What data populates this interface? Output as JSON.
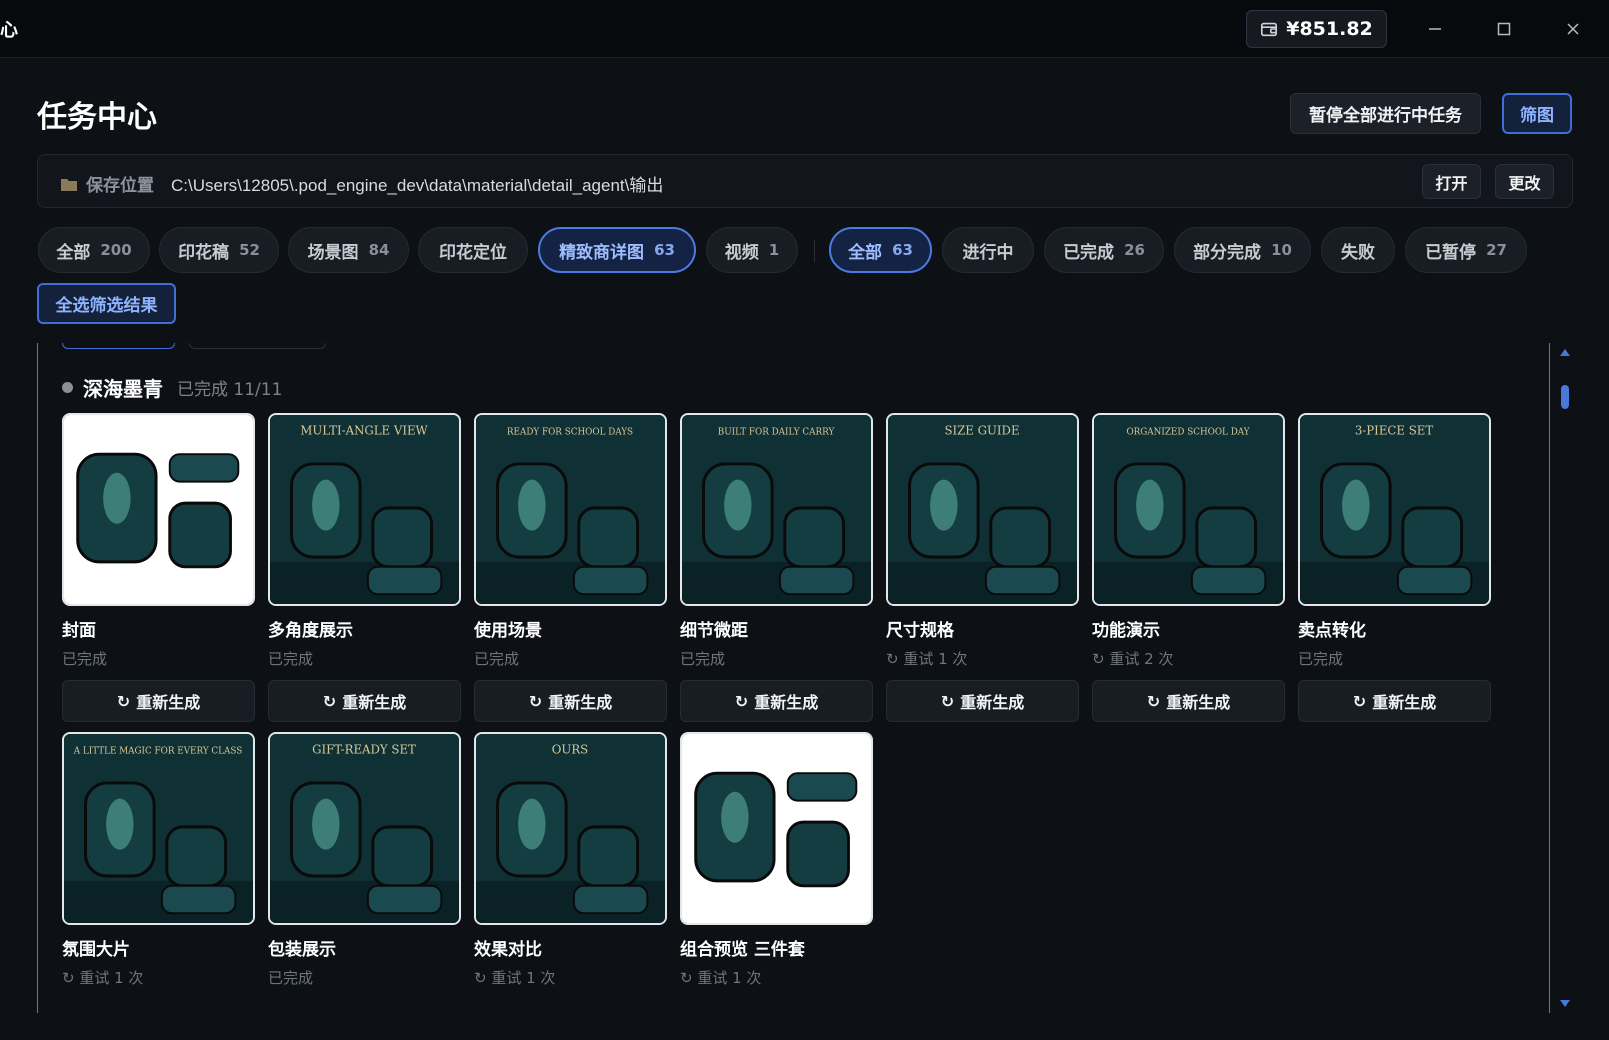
{
  "titlebar": {
    "logo_char": "心",
    "balance": "¥851.82",
    "icons": [
      "wallet-icon",
      "minimize-icon",
      "maximize-icon",
      "close-icon"
    ]
  },
  "header": {
    "title": "任务中心",
    "pause_all_label": "暂停全部进行中任务",
    "filter_label": "筛图"
  },
  "save_location": {
    "label": "保存位置",
    "path": "C:\\Users\\12805\\.pod_engine_dev\\data\\material\\detail_agent\\输出",
    "open_label": "打开",
    "change_label": "更改"
  },
  "type_filters": [
    {
      "label": "全部",
      "count": "200",
      "active": false
    },
    {
      "label": "印花稿",
      "count": "52",
      "active": false
    },
    {
      "label": "场景图",
      "count": "84",
      "active": false
    },
    {
      "label": "印花定位",
      "count": "",
      "active": false
    },
    {
      "label": "精致商详图",
      "count": "63",
      "active": true
    },
    {
      "label": "视频",
      "count": "1",
      "active": false
    }
  ],
  "status_filters": [
    {
      "label": "全部",
      "count": "63",
      "active": true
    },
    {
      "label": "进行中",
      "count": "",
      "active": false
    },
    {
      "label": "已完成",
      "count": "26",
      "active": false
    },
    {
      "label": "部分完成",
      "count": "10",
      "active": false
    },
    {
      "label": "失败",
      "count": "",
      "active": false
    },
    {
      "label": "已暂停",
      "count": "27",
      "active": false
    }
  ],
  "select_all_label": "全选筛选结果",
  "group": {
    "name": "深海墨青",
    "status": "已完成 11/11"
  },
  "regen_label": "重新生成",
  "cards": [
    {
      "title": "封面",
      "status": "已完成",
      "image_text": ""
    },
    {
      "title": "多角度展示",
      "status": "已完成",
      "image_text": "MULTI-ANGLE VIEW"
    },
    {
      "title": "使用场景",
      "status": "已完成",
      "image_text": "READY FOR SCHOOL DAYS"
    },
    {
      "title": "细节微距",
      "status": "已完成",
      "image_text": "BUILT FOR DAILY CARRY"
    },
    {
      "title": "尺寸规格",
      "status": "↻ 重试 1 次",
      "image_text": "SIZE GUIDE"
    },
    {
      "title": "功能演示",
      "status": "↻ 重试 2 次",
      "image_text": "ORGANIZED SCHOOL DAY"
    },
    {
      "title": "卖点转化",
      "status": "已完成",
      "image_text": "3-PIECE SET"
    },
    {
      "title": "氛围大片",
      "status": "↻ 重试 1 次",
      "image_text": "A LITTLE MAGIC FOR EVERY CLASS"
    },
    {
      "title": "包装展示",
      "status": "已完成",
      "image_text": "GIFT-READY SET"
    },
    {
      "title": "效果对比",
      "status": "↻ 重试 1 次",
      "image_text": "OURS"
    },
    {
      "title": "组合预览 三件套",
      "status": "↻ 重试 1 次",
      "image_text": ""
    }
  ],
  "colors": {
    "accent": "#4b7be0",
    "background": "#0d1015",
    "teal": "#12343a"
  }
}
